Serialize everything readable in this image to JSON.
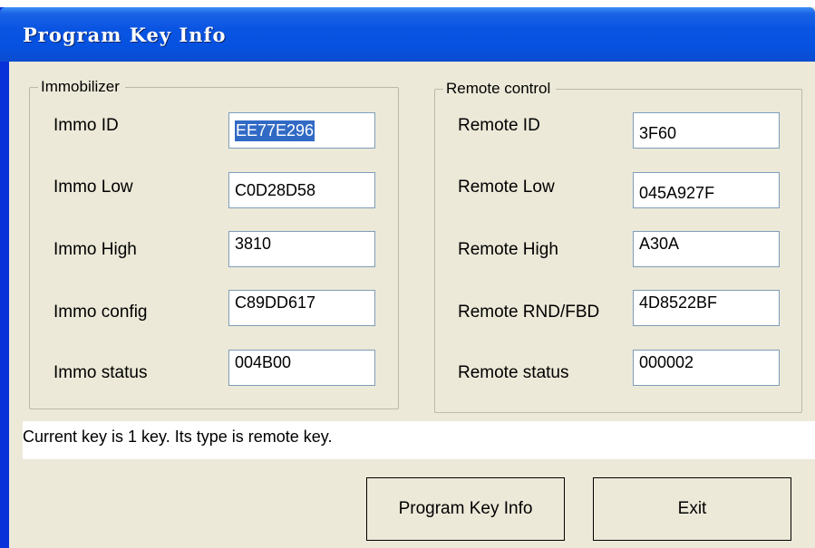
{
  "window": {
    "title": "Program Key Info"
  },
  "immobilizer": {
    "legend": "Immobilizer",
    "fields": [
      {
        "label": "Immo ID",
        "value": "EE77E296"
      },
      {
        "label": "Immo Low",
        "value": "C0D28D58"
      },
      {
        "label": "Immo High",
        "value": "3810"
      },
      {
        "label": "Immo config",
        "value": "C89DD617"
      },
      {
        "label": "Immo status",
        "value": "004B00"
      }
    ]
  },
  "remote": {
    "legend": "Remote control",
    "fields": [
      {
        "label": "Remote ID",
        "value": "3F60"
      },
      {
        "label": "Remote Low",
        "value": "045A927F"
      },
      {
        "label": "Remote High",
        "value": "A30A"
      },
      {
        "label": "Remote RND/FBD",
        "value": "4D8522BF"
      },
      {
        "label": "Remote status",
        "value": "000002"
      }
    ]
  },
  "status_text": "Current key is 1 key. Its type is remote key.",
  "buttons": {
    "program_label": "Program Key Info",
    "exit_label": "Exit"
  }
}
